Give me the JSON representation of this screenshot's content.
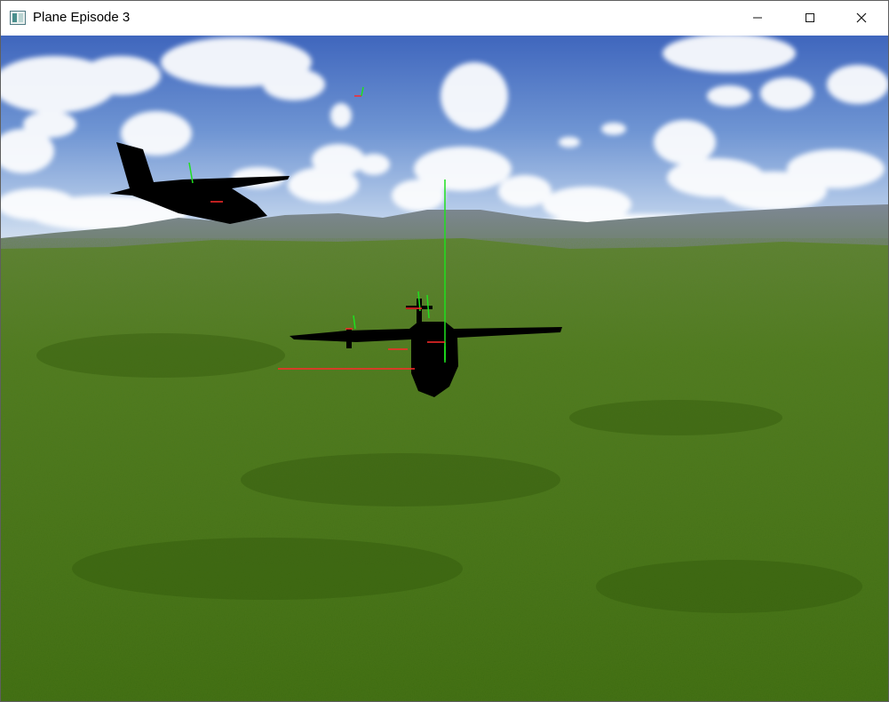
{
  "window": {
    "title": "Plane Episode 3",
    "icon": "window-app-icon",
    "controls": {
      "minimize": "minimize-icon",
      "maximize": "maximize-icon",
      "close": "close-icon"
    }
  },
  "scene": {
    "sky_top": "#3d63ba",
    "sky_horizon": "#c9d8ee",
    "ground_near": "#3f6a12",
    "ground_far": "#5f8a36",
    "mountains": "#6d7d8d",
    "debug_axis_x_color": "#ff2a2a",
    "debug_axis_y_color": "#1fe01f"
  }
}
